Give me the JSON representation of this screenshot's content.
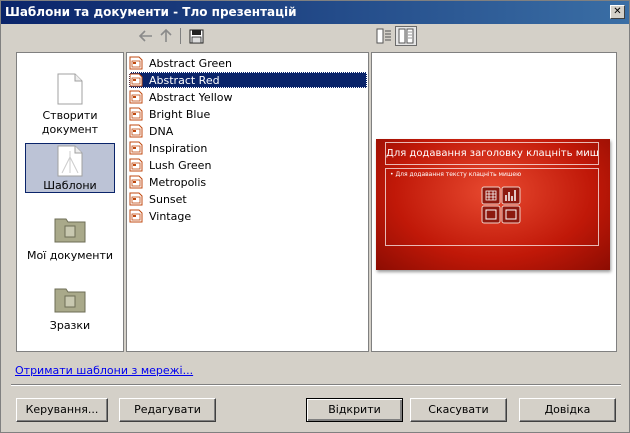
{
  "window": {
    "title": "Шаблони та документи - Тло презентацій"
  },
  "categories": [
    {
      "label1": "Створити",
      "label2": "документ",
      "selected": false
    },
    {
      "label1": "Шаблони",
      "label2": "",
      "selected": true
    },
    {
      "label1": "Мої документи",
      "label2": "",
      "selected": false
    },
    {
      "label1": "Зразки",
      "label2": "",
      "selected": false
    }
  ],
  "templates": [
    "Abstract Green",
    "Abstract Red",
    "Abstract Yellow",
    "Bright Blue",
    "DNA",
    "Inspiration",
    "Lush Green",
    "Metropolis",
    "Sunset",
    "Vintage"
  ],
  "selected_template_index": 1,
  "preview": {
    "title_placeholder": "Для додавання заголовку клацніть мишею",
    "text_placeholder": "• Для додавання тексту клацніть мишею"
  },
  "link": {
    "get_templates": "Отримати шаблони з мережі..."
  },
  "buttons": {
    "manage": "Керування...",
    "edit": "Редагувати",
    "open": "Відкрити",
    "cancel": "Скасувати",
    "help": "Довідка"
  },
  "colors": {
    "titlebar": "#0a246a",
    "selection": "#0a246a",
    "slide_red": "#c01808"
  }
}
